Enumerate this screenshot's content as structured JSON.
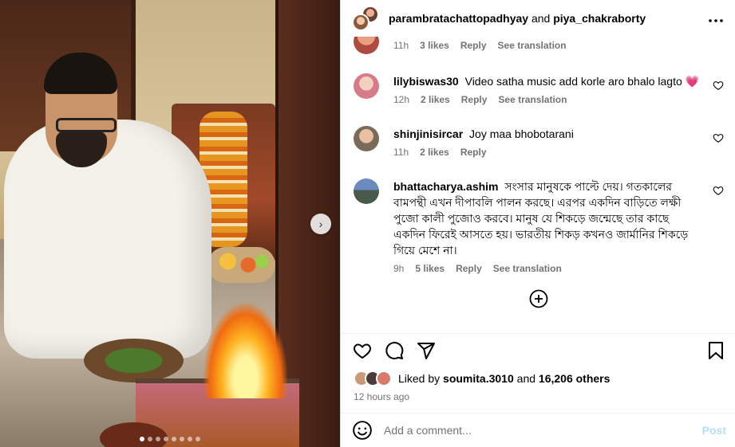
{
  "header": {
    "user1": "parambratachattopadhyay",
    "and": "and",
    "user2": "piya_chakraborty",
    "more_icon": "more-horizontal-icon"
  },
  "comments": [
    {
      "username": "",
      "text": "",
      "time": "11h",
      "likes": "3 likes",
      "reply": "Reply",
      "translate": "See translation"
    },
    {
      "username": "lilybiswas30",
      "text": "Video satha music add korle aro bhalo lagto",
      "emoji": "💗",
      "time": "12h",
      "likes": "2 likes",
      "reply": "Reply",
      "translate": "See translation"
    },
    {
      "username": "shinjinisircar",
      "text": "Joy maa bhobotarani",
      "time": "11h",
      "likes": "2 likes",
      "reply": "Reply"
    },
    {
      "username": "bhattacharya.ashim",
      "text": "সংসার মানুষকে পাল্টে দেয়। গতকালের বামপন্থী এখন দীপাবলি পালন করছে। এরপর একদিন বাড়িতে লক্ষী পুজো কালী পুজোও করবে। মানুষ যে শিকড়ে জন্মেছে তার কাছে একদিন ফিরেই আসতে হয়। ভারতীয় শিকড় কখনও জার্মানির শিকড়ে গিয়ে মেশে না।",
      "time": "9h",
      "likes": "5 likes",
      "reply": "Reply",
      "translate": "See translation"
    }
  ],
  "actions": {
    "liked_by_prefix": "Liked by",
    "liked_by_user": "soumita.3010",
    "liked_by_and": "and",
    "liked_by_others": "16,206 others",
    "posted_ago": "12 hours ago"
  },
  "comment_box": {
    "placeholder": "Add a comment...",
    "post_label": "Post"
  },
  "carousel": {
    "slide_count": 8,
    "active_index": 0,
    "next_arrow": "›"
  },
  "colors": {
    "muted_text": "#737373",
    "post_disabled": "#b2dffc",
    "heart_emoji": "#e8457a"
  }
}
